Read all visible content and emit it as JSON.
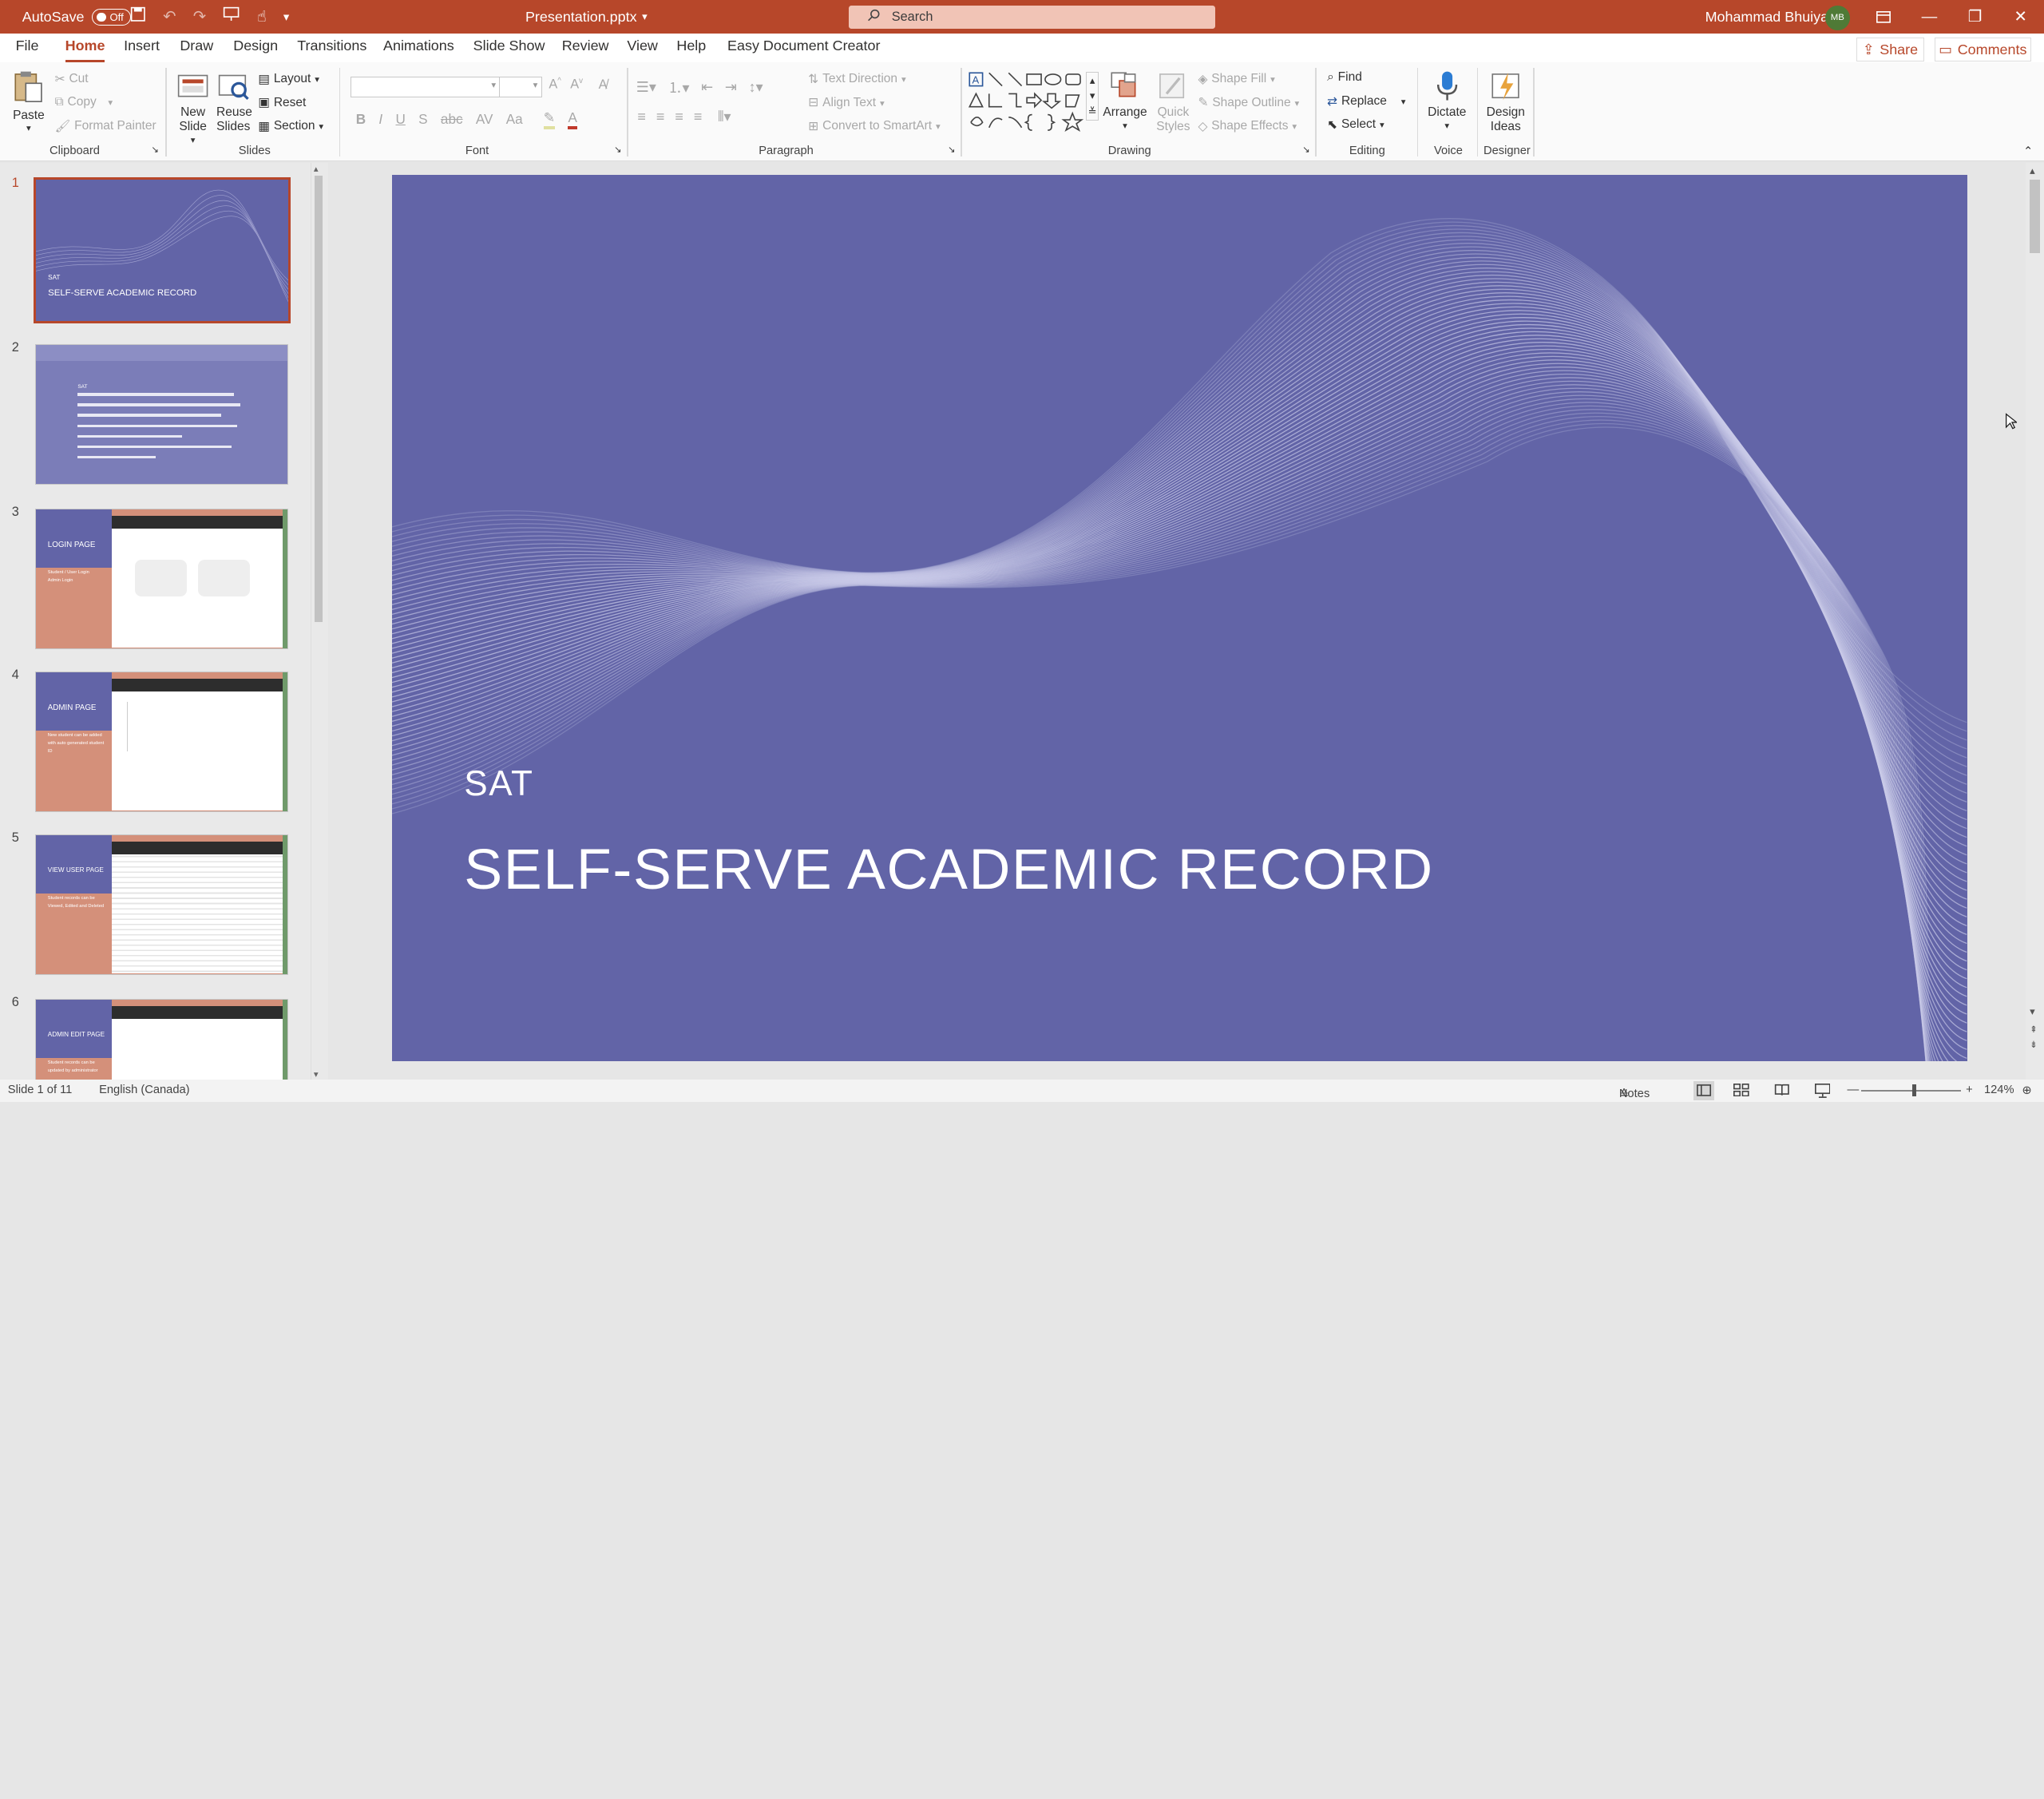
{
  "titlebar": {
    "autosave_label": "AutoSave",
    "autosave_state": "Off",
    "filename": "Presentation.pptx",
    "search_placeholder": "Search",
    "user_name": "Mohammad Bhuiyan",
    "user_initials": "MB"
  },
  "tabs": [
    "File",
    "Home",
    "Insert",
    "Draw",
    "Design",
    "Transitions",
    "Animations",
    "Slide Show",
    "Review",
    "View",
    "Help",
    "Easy Document Creator"
  ],
  "active_tab": "Home",
  "actions": {
    "share": "Share",
    "comments": "Comments"
  },
  "ribbon": {
    "clipboard": {
      "paste": "Paste",
      "cut": "Cut",
      "copy": "Copy",
      "format_painter": "Format Painter",
      "label": "Clipboard"
    },
    "slides": {
      "new_slide": "New Slide",
      "reuse_slides": "Reuse Slides",
      "layout": "Layout",
      "reset": "Reset",
      "section": "Section",
      "label": "Slides"
    },
    "font": {
      "label": "Font"
    },
    "paragraph": {
      "text_direction": "Text Direction",
      "align_text": "Align Text",
      "convert_smartart": "Convert to SmartArt",
      "label": "Paragraph"
    },
    "drawing": {
      "arrange": "Arrange",
      "quick_styles": "Quick Styles",
      "shape_fill": "Shape Fill",
      "shape_outline": "Shape Outline",
      "shape_effects": "Shape Effects",
      "label": "Drawing"
    },
    "editing": {
      "find": "Find",
      "replace": "Replace",
      "select": "Select",
      "label": "Editing"
    },
    "voice": {
      "dictate": "Dictate",
      "label": "Voice"
    },
    "designer": {
      "design_ideas": "Design Ideas",
      "label": "Designer"
    }
  },
  "thumbnails": [
    {
      "num": "1",
      "title": "SELF-SERVE ACADEMIC RECORD",
      "sub": "SAT"
    },
    {
      "num": "2",
      "title": "SAT"
    },
    {
      "num": "3",
      "title": "LOGIN PAGE",
      "body": "Student / User Login\nAdmin Login"
    },
    {
      "num": "4",
      "title": "ADMIN PAGE",
      "body": "New student can be added with auto generated student ID"
    },
    {
      "num": "5",
      "title": "VIEW USER PAGE",
      "body": "Student records can be Viewed, Edited and Deleted"
    },
    {
      "num": "6",
      "title": "ADMIN EDIT PAGE",
      "body": "Student records can be updated by administrator"
    }
  ],
  "slide": {
    "subtitle": "SAT",
    "title": "SELF-SERVE ACADEMIC RECORD"
  },
  "status": {
    "slide_info": "Slide 1 of 11",
    "language": "English (Canada)",
    "notes": "Notes",
    "zoom": "124%"
  },
  "colors": {
    "accent": "#b7472a",
    "slide_bg": "#6264a7",
    "thumb_salmon": "#d4907a"
  }
}
